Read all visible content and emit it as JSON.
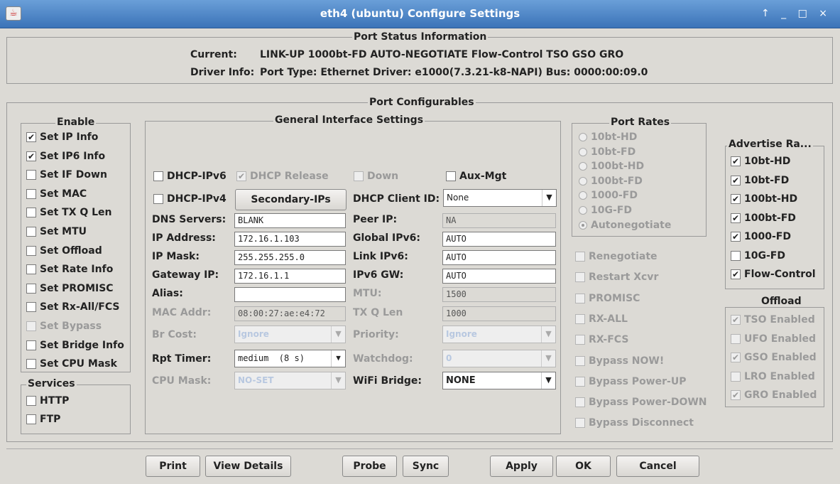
{
  "window": {
    "title": "eth4  (ubuntu) Configure Settings",
    "controls": "↑ _ □ ×"
  },
  "status": {
    "title": "Port Status Information",
    "current_label": "Current:",
    "current_value": "LINK-UP 1000bt-FD AUTO-NEGOTIATE Flow-Control TSO GSO GRO",
    "driver_label": "Driver Info:",
    "driver_value": "Port Type: Ethernet  Driver: e1000(7.3.21-k8-NAPI)  Bus: 0000:00:09.0"
  },
  "configurables_title": "Port Configurables",
  "enable": {
    "title": "Enable",
    "items": [
      {
        "label": "Set IP Info",
        "checked": true
      },
      {
        "label": "Set IP6 Info",
        "checked": true
      },
      {
        "label": "Set IF Down",
        "checked": false
      },
      {
        "label": "Set MAC",
        "checked": false
      },
      {
        "label": "Set TX Q Len",
        "checked": false
      },
      {
        "label": "Set MTU",
        "checked": false
      },
      {
        "label": "Set Offload",
        "checked": false
      },
      {
        "label": "Set Rate Info",
        "checked": false
      },
      {
        "label": "Set PROMISC",
        "checked": false
      },
      {
        "label": "Set Rx-All/FCS",
        "checked": false
      },
      {
        "label": "Set Bypass",
        "checked": false
      },
      {
        "label": "Set Bridge Info",
        "checked": false
      },
      {
        "label": "Set CPU Mask",
        "checked": false
      }
    ]
  },
  "services": {
    "title": "Services",
    "items": [
      {
        "label": "HTTP"
      },
      {
        "label": "FTP"
      }
    ]
  },
  "general": {
    "title": "General Interface Settings",
    "dhcp_ipv6": "DHCP-IPv6",
    "dhcp_release": "DHCP Release",
    "down": "Down",
    "aux_mgt": "Aux-Mgt",
    "dhcp_ipv4": "DHCP-IPv4",
    "secondary_ips": "Secondary-IPs",
    "dhcp_client_id_label": "DHCP Client ID:",
    "dhcp_client_id": "None",
    "dns_label": "DNS Servers:",
    "dns": "BLANK",
    "peer_label": "Peer IP:",
    "peer": "NA",
    "ip_label": "IP Address:",
    "ip": "172.16.1.103",
    "global6_label": "Global IPv6:",
    "global6": "AUTO",
    "mask_label": "IP Mask:",
    "mask": "255.255.255.0",
    "link6_label": "Link IPv6:",
    "link6": "AUTO",
    "gw_label": "Gateway IP:",
    "gw": "172.16.1.1",
    "gw6_label": "IPv6 GW:",
    "gw6": "AUTO",
    "alias_label": "Alias:",
    "alias": "",
    "mtu_label": "MTU:",
    "mtu": "1500",
    "mac_label": "MAC Addr:",
    "mac": "08:00:27:ae:e4:72",
    "txq_label": "TX Q Len",
    "txq": "1000",
    "brcost_label": "Br Cost:",
    "brcost": "Ignore",
    "priority_label": "Priority:",
    "priority": "Ignore",
    "rpt_label": "Rpt Timer:",
    "rpt": "medium  (8 s)",
    "watchdog_label": "Watchdog:",
    "watchdog": "0",
    "cpumask_label": "CPU Mask:",
    "cpumask": "NO-SET",
    "wifi_label": "WiFi Bridge:",
    "wifi": "NONE"
  },
  "port_rates": {
    "title": "Port Rates",
    "items": [
      {
        "label": "10bt-HD",
        "selected": false
      },
      {
        "label": "10bt-FD",
        "selected": false
      },
      {
        "label": "100bt-HD",
        "selected": false
      },
      {
        "label": "100bt-FD",
        "selected": false
      },
      {
        "label": "1000-FD",
        "selected": false
      },
      {
        "label": "10G-FD",
        "selected": false
      },
      {
        "label": "Autonegotiate",
        "selected": true
      }
    ]
  },
  "misc": {
    "items": [
      {
        "label": "Renegotiate"
      },
      {
        "label": "Restart Xcvr"
      },
      {
        "label": "PROMISC"
      },
      {
        "label": "RX-ALL"
      },
      {
        "label": "RX-FCS"
      },
      {
        "label": "Bypass NOW!"
      },
      {
        "label": "Bypass Power-UP"
      },
      {
        "label": "Bypass Power-DOWN"
      },
      {
        "label": "Bypass Disconnect"
      }
    ]
  },
  "advertise": {
    "title": "Advertise Ra...",
    "items": [
      {
        "label": "10bt-HD",
        "checked": true
      },
      {
        "label": "10bt-FD",
        "checked": true
      },
      {
        "label": "100bt-HD",
        "checked": true
      },
      {
        "label": "100bt-FD",
        "checked": true
      },
      {
        "label": "1000-FD",
        "checked": true
      },
      {
        "label": "10G-FD",
        "checked": false
      },
      {
        "label": "Flow-Control",
        "checked": true
      }
    ]
  },
  "offload": {
    "title": "Offload",
    "items": [
      {
        "label": "TSO Enabled",
        "checked": true
      },
      {
        "label": "UFO Enabled",
        "checked": false
      },
      {
        "label": "GSO Enabled",
        "checked": true
      },
      {
        "label": "LRO Enabled",
        "checked": false
      },
      {
        "label": "GRO Enabled",
        "checked": true
      }
    ]
  },
  "buttons": {
    "print": "Print",
    "details": "View Details",
    "probe": "Probe",
    "sync": "Sync",
    "apply": "Apply",
    "ok": "OK",
    "cancel": "Cancel"
  }
}
